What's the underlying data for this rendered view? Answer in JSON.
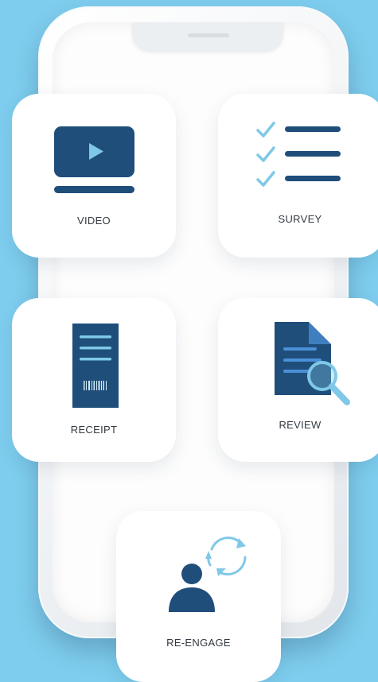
{
  "cards": {
    "video": {
      "label": "VIDEO"
    },
    "survey": {
      "label": "SURVEY"
    },
    "receipt": {
      "label": "RECEIPT"
    },
    "review": {
      "label": "REVIEW"
    },
    "reengage": {
      "label": "RE-ENGAGE"
    }
  },
  "icons": {
    "video": "video-player-icon",
    "survey": "checklist-icon",
    "receipt": "receipt-barcode-icon",
    "review": "document-search-icon",
    "reengage": "user-refresh-icon"
  },
  "colors": {
    "background": "#7ecdee",
    "icon_dark": "#1f4e7a",
    "icon_light": "#7fc8e8"
  }
}
